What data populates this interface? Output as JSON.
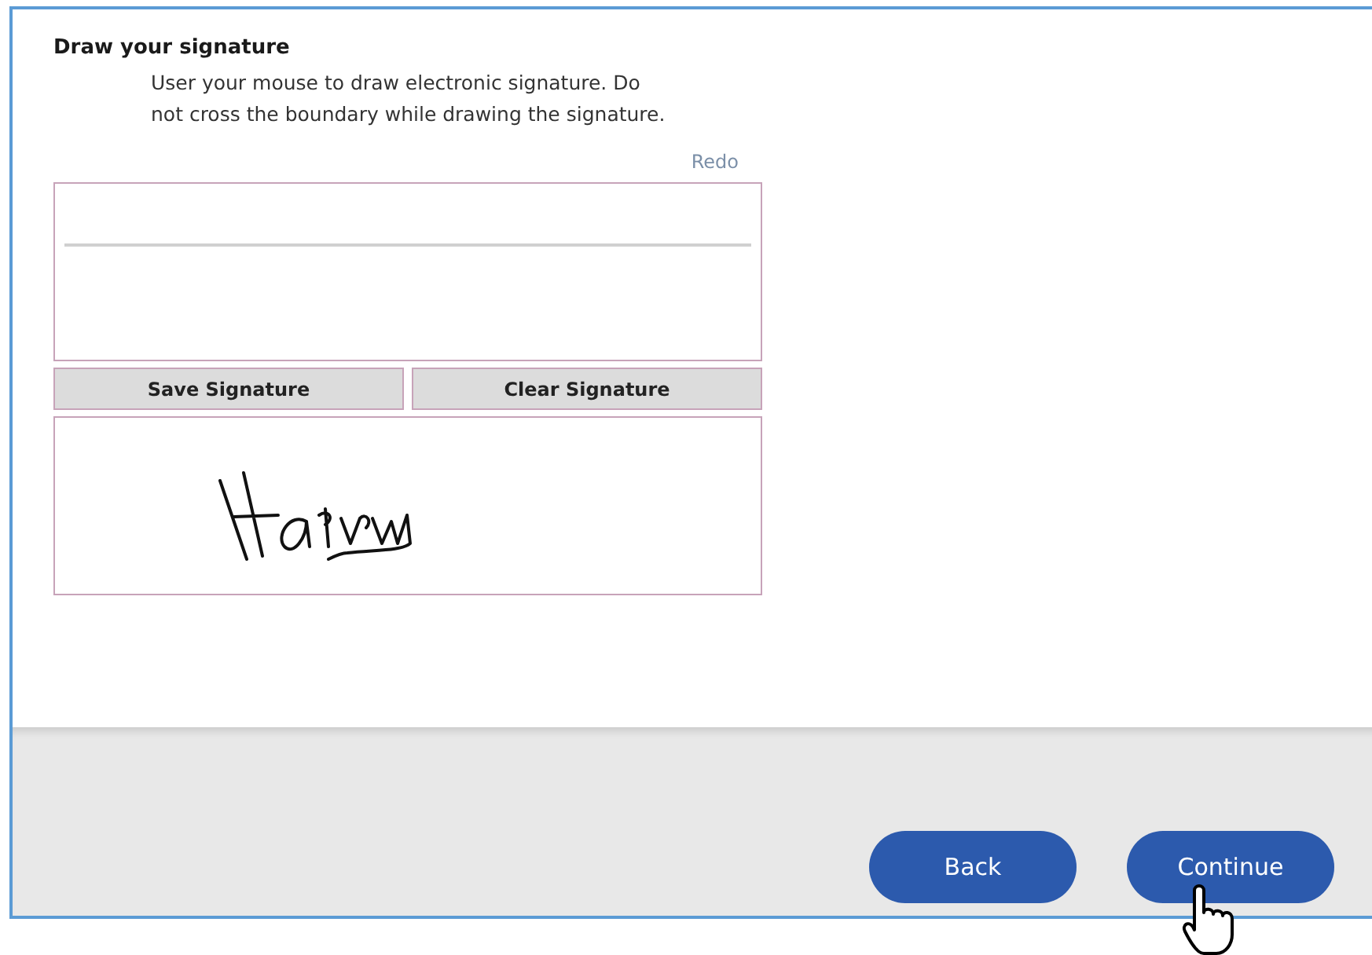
{
  "heading": "Draw your signature",
  "instructions": "User your mouse to draw electronic signature. Do not cross the boundary while drawing the signature.",
  "redo_link": "Redo",
  "pad_buttons": [
    "Save Signature",
    "Clear Signature"
  ],
  "footer_buttons": [
    "Back",
    "Continue"
  ]
}
